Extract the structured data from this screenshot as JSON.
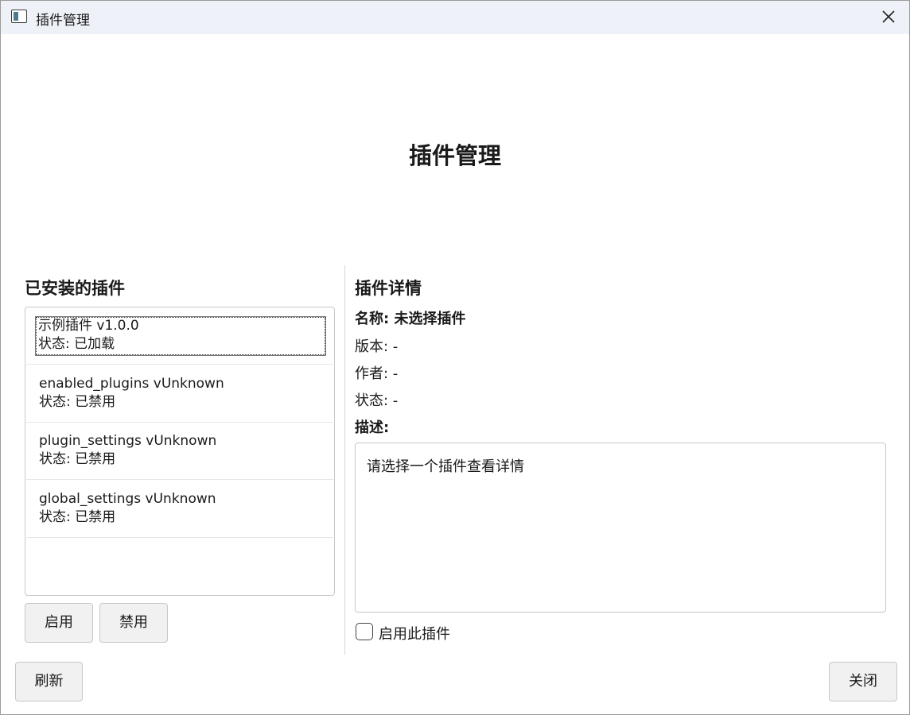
{
  "window": {
    "title": "插件管理"
  },
  "page": {
    "heading": "插件管理"
  },
  "installed": {
    "title": "已安装的插件",
    "items": [
      {
        "name_version": "示例插件 v1.0.0",
        "status": "状态: 已加载",
        "selected": true
      },
      {
        "name_version": "enabled_plugins vUnknown",
        "status": "状态: 已禁用"
      },
      {
        "name_version": "plugin_settings vUnknown",
        "status": "状态: 已禁用"
      },
      {
        "name_version": "global_settings vUnknown",
        "status": "状态: 已禁用"
      }
    ],
    "enable_label": "启用",
    "disable_label": "禁用"
  },
  "details": {
    "title": "插件详情",
    "name": "名称: 未选择插件",
    "version": "版本: -",
    "author": "作者: -",
    "status": "状态: -",
    "description_label": "描述:",
    "description_text": "请选择一个插件查看详情",
    "enable_checkbox_label": "启用此插件",
    "enable_checkbox_checked": false
  },
  "footer": {
    "refresh_label": "刷新",
    "close_label": "关闭"
  },
  "icons": {
    "app": "window-app-icon",
    "close": "close-icon"
  }
}
